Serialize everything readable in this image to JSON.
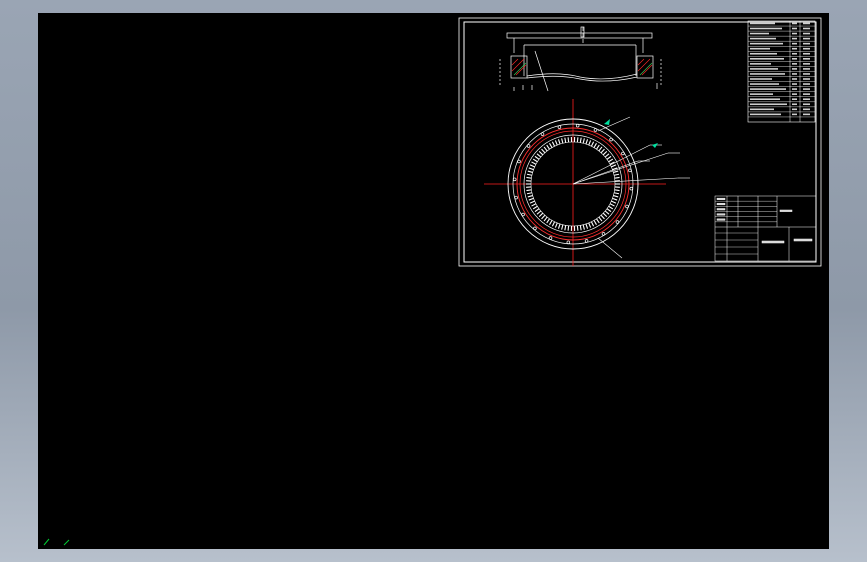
{
  "viewport": {
    "background": "#000000",
    "frame_color": "#ffffff",
    "center_line_color": "#ff2020",
    "bolt_circle_color": "#ff3030",
    "leader_color": "#ffffff",
    "arrow_color": "#00e0a0",
    "ucs_color": "#00cc33"
  },
  "drawing_sheet": {
    "parameter_rows": 20,
    "title_block_rows": 6,
    "outer_holes": 20,
    "teeth": 90,
    "leader_lines": 4
  }
}
